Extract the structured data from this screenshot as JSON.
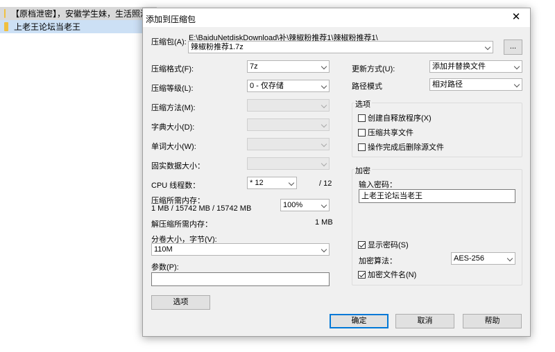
{
  "background_list": {
    "items": [
      {
        "label": "【原档泄密】，安徽学生妹，生活照清新"
      },
      {
        "label": "上老王论坛当老王"
      }
    ]
  },
  "dialog": {
    "title": "添加到压缩包",
    "archive": {
      "label": "压缩包(A):",
      "path": "E:\\BaiduNetdiskDownload\\补\\辣椒粉推荐1\\辣椒粉推荐1\\",
      "name": "辣椒粉推荐1.7z",
      "browse_label": "..."
    },
    "format": {
      "label": "压缩格式(F):",
      "value": "7z"
    },
    "level": {
      "label": "压缩等级(L):",
      "value": "0 - 仅存储"
    },
    "method": {
      "label": "压缩方法(M):",
      "value": ""
    },
    "dict_size": {
      "label": "字典大小(D):",
      "value": ""
    },
    "word_size": {
      "label": "单词大小(W):",
      "value": ""
    },
    "solid_size": {
      "label": "固实数据大小：",
      "value": ""
    },
    "threads": {
      "label": "CPU 线程数：",
      "value": "* 12",
      "max": "/ 12"
    },
    "mem_compress": {
      "label": "压缩所需内存：",
      "detail": "1 MB / 15742 MB / 15742 MB",
      "percent": "100%"
    },
    "mem_decompress": {
      "label": "解压缩所需内存：",
      "value": "1 MB"
    },
    "volume": {
      "label": "分卷大小，字节(V):",
      "value": "110M"
    },
    "params": {
      "label": "参数(P):",
      "value": ""
    },
    "options_button": "选项",
    "update_mode": {
      "label": "更新方式(U):",
      "value": "添加并替换文件"
    },
    "path_mode": {
      "label": "路径模式",
      "value": "相对路径"
    },
    "options_group": {
      "title": "选项",
      "sfx": "创建自释放程序(X)",
      "shared": "压缩共享文件",
      "delete_after": "操作完成后删除源文件"
    },
    "encryption": {
      "title": "加密",
      "password_label": "输入密码：",
      "password_value": "上老王论坛当老王",
      "show_password": "显示密码(S)",
      "method_label": "加密算法：",
      "method_value": "AES-256",
      "encrypt_names": "加密文件名(N)"
    },
    "buttons": {
      "ok": "确定",
      "cancel": "取消",
      "help": "帮助"
    }
  }
}
